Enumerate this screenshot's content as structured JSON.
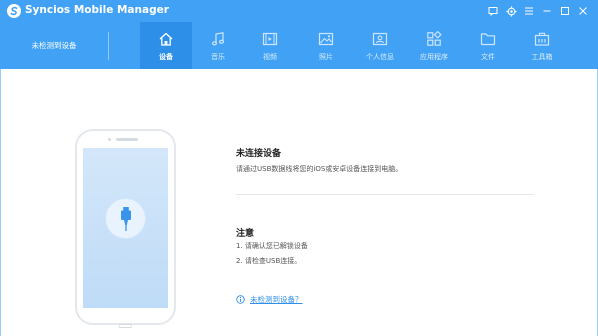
{
  "window": {
    "title": "Syncios Mobile Manager",
    "controls": [
      {
        "name": "feedback-icon"
      },
      {
        "name": "gear-icon"
      },
      {
        "name": "menu-icon"
      },
      {
        "name": "minimize-icon"
      },
      {
        "name": "maximize-icon"
      },
      {
        "name": "close-icon"
      }
    ]
  },
  "nav": {
    "device_status": "未检测到设备",
    "tabs": [
      {
        "label": "设备",
        "icon": "home-icon",
        "active": true
      },
      {
        "label": "音乐",
        "icon": "music-icon",
        "active": false
      },
      {
        "label": "视频",
        "icon": "video-icon",
        "active": false
      },
      {
        "label": "照片",
        "icon": "photo-icon",
        "active": false
      },
      {
        "label": "个人信息",
        "icon": "contact-card-icon",
        "active": false
      },
      {
        "label": "应用程序",
        "icon": "apps-icon",
        "active": false
      },
      {
        "label": "文件",
        "icon": "folder-icon",
        "active": false
      },
      {
        "label": "工具箱",
        "icon": "toolbox-icon",
        "active": false
      }
    ]
  },
  "main": {
    "heading": "未连接设备",
    "instruction": "请通过USB数据线将您的iOS或安卓设备连接到电脑。",
    "note_heading": "注意",
    "notes": [
      "1. 请确认您已解锁设备",
      "2. 请检查USB连接。"
    ],
    "help_link": "未检测到设备？"
  },
  "colors": {
    "brand_blue": "#41a2f5",
    "active_tab": "#2e8fe8",
    "link": "#2e8fe8"
  }
}
